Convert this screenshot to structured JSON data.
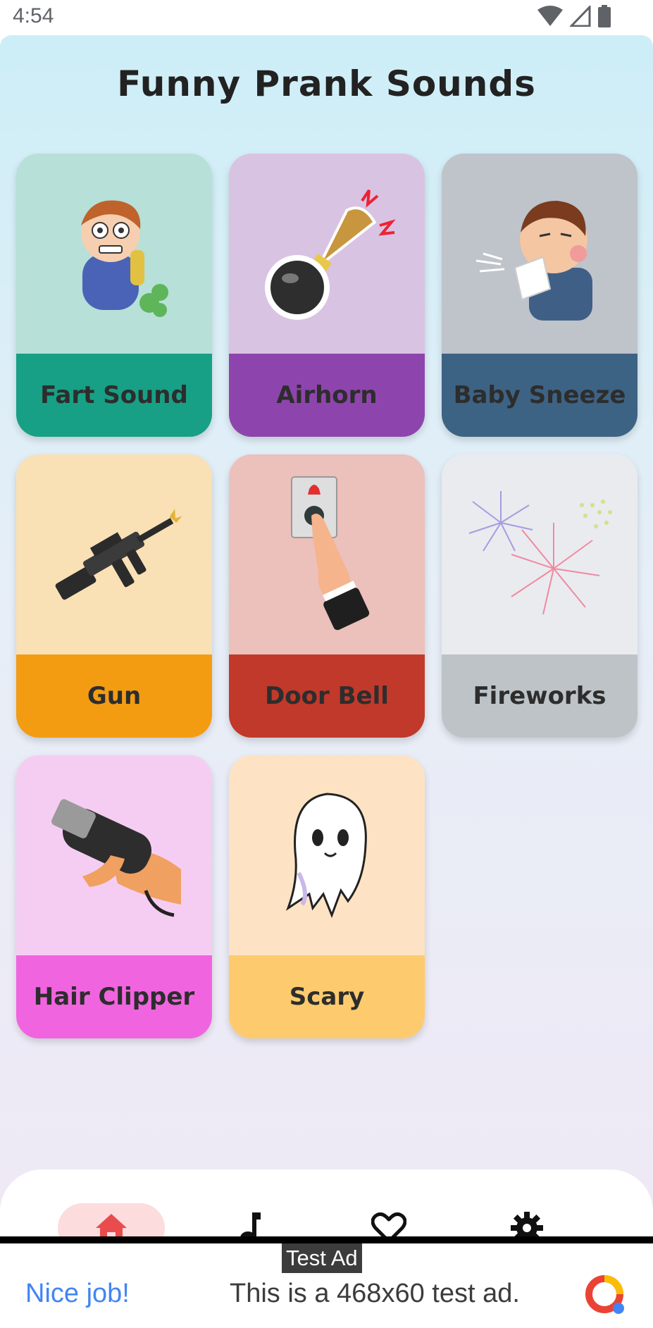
{
  "status_bar": {
    "time": "4:54",
    "icons": [
      "wifi-icon",
      "signal-icon",
      "battery-icon"
    ]
  },
  "app": {
    "title": "Funny Prank Sounds"
  },
  "sounds": [
    {
      "label": "Fart Sound",
      "icon": "fart-boy-icon",
      "top_color": "#b6e0d8",
      "bottom_color": "#17a085"
    },
    {
      "label": "Airhorn",
      "icon": "airhorn-icon",
      "top_color": "#d9c3e3",
      "bottom_color": "#8e44ad"
    },
    {
      "label": "Baby Sneeze",
      "icon": "sneezing-boy-icon",
      "top_color": "#bfc3ca",
      "bottom_color": "#3d6384"
    },
    {
      "label": "Gun",
      "icon": "rifle-icon",
      "top_color": "#fae0b5",
      "bottom_color": "#f39c12"
    },
    {
      "label": "Door Bell",
      "icon": "doorbell-icon",
      "top_color": "#ecc0bb",
      "bottom_color": "#c0392b"
    },
    {
      "label": "Fireworks",
      "icon": "fireworks-icon",
      "top_color": "#e9ebef",
      "bottom_color": "#bdc3c7"
    },
    {
      "label": "Hair Clipper",
      "icon": "hair-clipper-icon",
      "top_color": "#f6cdf2",
      "bottom_color": "#f164e0"
    },
    {
      "label": "Scary",
      "icon": "ghost-icon",
      "top_color": "#fde3c4",
      "bottom_color": "#fdcb6e"
    }
  ],
  "bottom_nav": {
    "items": [
      {
        "name": "home",
        "icon": "home-icon",
        "active": true,
        "color": "#e84c4c"
      },
      {
        "name": "music",
        "icon": "music-note-icon",
        "active": false
      },
      {
        "name": "favorites",
        "icon": "heart-icon",
        "active": false
      },
      {
        "name": "settings",
        "icon": "gear-icon",
        "active": false
      }
    ]
  },
  "ad": {
    "tag": "Test Ad",
    "headline": "Nice job!",
    "body": "This is a 468x60 test ad.",
    "logo_icon": "ad-logo-icon"
  }
}
